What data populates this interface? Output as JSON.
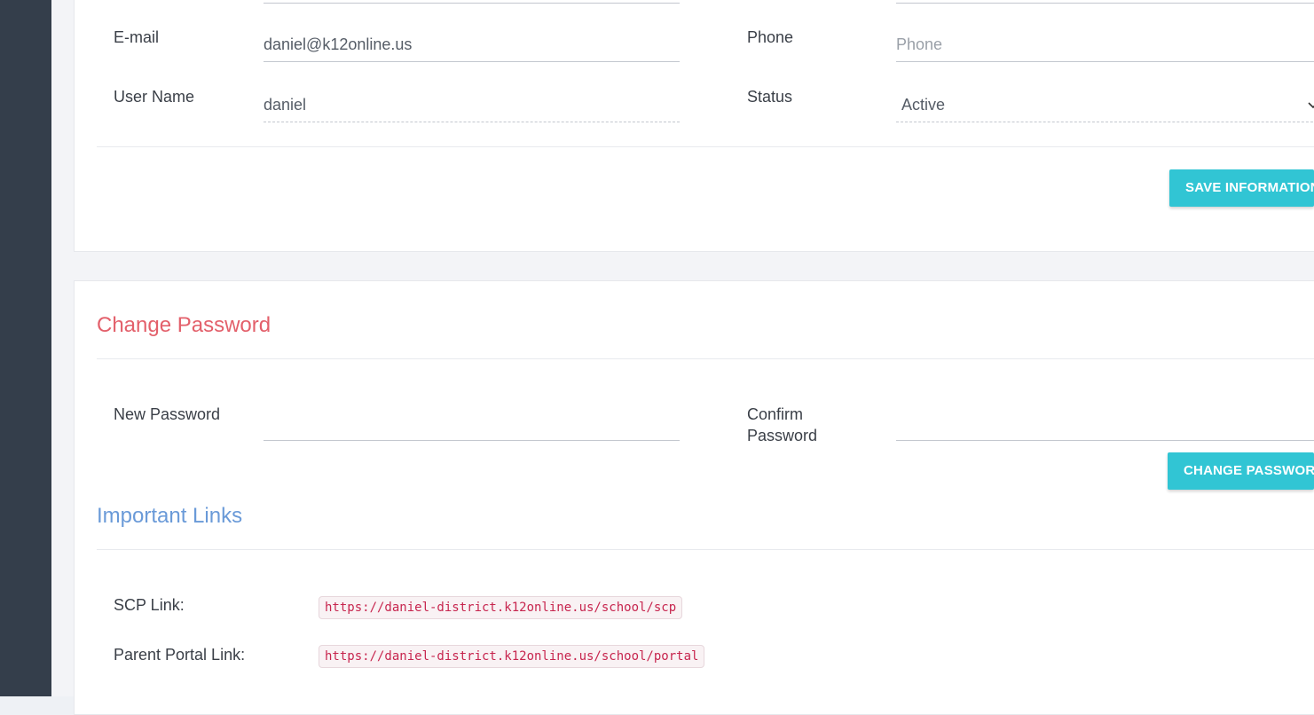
{
  "profile": {
    "email_label": "E-mail",
    "email_value": "daniel@k12online.us",
    "phone_label": "Phone",
    "phone_placeholder": "Phone",
    "username_label": "User Name",
    "username_value": "daniel",
    "status_label": "Status",
    "status_value": "Active",
    "save_button": "SAVE INFORMATION"
  },
  "password": {
    "title": "Change Password",
    "new_label": "New Password",
    "new_value": "",
    "confirm_label_line1": "Confirm",
    "confirm_label_line2": "Password",
    "confirm_value": "",
    "change_button": "CHANGE PASSWORD"
  },
  "links": {
    "title": "Important Links",
    "scp_label": "SCP Link:",
    "scp_url": "https://daniel-district.k12online.us/school/scp",
    "parent_label": "Parent Portal Link:",
    "parent_url": "https://daniel-district.k12online.us/school/portal"
  },
  "colors": {
    "sidebar": "#343e4b",
    "accent_button": "#31c5d4",
    "title_red": "#e3606b",
    "title_blue": "#6a9ad8",
    "code_text": "#c7254e"
  },
  "icons": {
    "status_select": "chevron-down-icon"
  }
}
